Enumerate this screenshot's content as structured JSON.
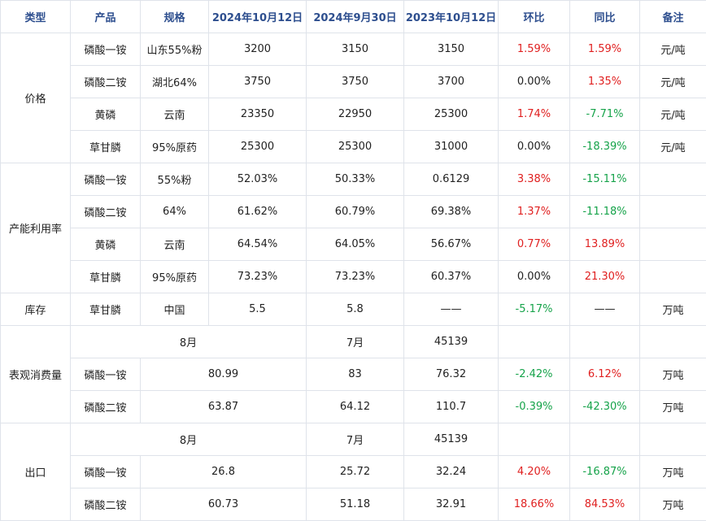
{
  "header": [
    "类型",
    "产品",
    "规格",
    "2024年10月12日",
    "2024年9月30日",
    "2023年10月12日",
    "环比",
    "同比",
    "备注"
  ],
  "sections": {
    "price": {
      "category": "价格",
      "rows": [
        {
          "product": "磷酸一铵",
          "spec": "山东55%粉",
          "v1": "3200",
          "v2": "3150",
          "v3": "3150",
          "mom": "1.59%",
          "yoy": "1.59%",
          "note": "元/吨"
        },
        {
          "product": "磷酸二铵",
          "spec": "湖北64%",
          "v1": "3750",
          "v2": "3750",
          "v3": "3700",
          "mom": "0.00%",
          "yoy": "1.35%",
          "note": "元/吨"
        },
        {
          "product": "黄磷",
          "spec": "云南",
          "v1": "23350",
          "v2": "22950",
          "v3": "25300",
          "mom": "1.74%",
          "yoy": "-7.71%",
          "note": "元/吨"
        },
        {
          "product": "草甘膦",
          "spec": "95%原药",
          "v1": "25300",
          "v2": "25300",
          "v3": "31000",
          "mom": "0.00%",
          "yoy": "-18.39%",
          "note": "元/吨"
        }
      ]
    },
    "capacity": {
      "category": "产能利用率",
      "rows": [
        {
          "product": "磷酸一铵",
          "spec": "55%粉",
          "v1": "52.03%",
          "v2": "50.33%",
          "v3": "0.6129",
          "mom": "3.38%",
          "yoy": "-15.11%",
          "note": ""
        },
        {
          "product": "磷酸二铵",
          "spec": "64%",
          "v1": "61.62%",
          "v2": "60.79%",
          "v3": "69.38%",
          "mom": "1.37%",
          "yoy": "-11.18%",
          "note": ""
        },
        {
          "product": "黄磷",
          "spec": "云南",
          "v1": "64.54%",
          "v2": "64.05%",
          "v3": "56.67%",
          "mom": "0.77%",
          "yoy": "13.89%",
          "note": ""
        },
        {
          "product": "草甘膦",
          "spec": "95%原药",
          "v1": "73.23%",
          "v2": "73.23%",
          "v3": "60.37%",
          "mom": "0.00%",
          "yoy": "21.30%",
          "note": ""
        }
      ]
    },
    "inventory": {
      "category": "库存",
      "rows": [
        {
          "product": "草甘膦",
          "spec": "中国",
          "v1": "5.5",
          "v2": "5.8",
          "v3": "——",
          "mom": "-5.17%",
          "yoy": "——",
          "note": "万吨"
        }
      ]
    },
    "consumption": {
      "category": "表观消费量",
      "subheader": {
        "c1": "8月",
        "c2": "7月",
        "c3": "45139"
      },
      "rows": [
        {
          "product": "磷酸一铵",
          "v1": "80.99",
          "v2": "83",
          "v3": "76.32",
          "mom": "-2.42%",
          "yoy": "6.12%",
          "note": "万吨"
        },
        {
          "product": "磷酸二铵",
          "v1": "63.87",
          "v2": "64.12",
          "v3": "110.7",
          "mom": "-0.39%",
          "yoy": "-42.30%",
          "note": "万吨"
        }
      ]
    },
    "export": {
      "category": "出口",
      "subheader": {
        "c1": "8月",
        "c2": "7月",
        "c3": "45139"
      },
      "rows": [
        {
          "product": "磷酸一铵",
          "v1": "26.8",
          "v2": "25.72",
          "v3": "32.24",
          "mom": "4.20%",
          "yoy": "-16.87%",
          "note": "万吨"
        },
        {
          "product": "磷酸二铵",
          "v1": "60.73",
          "v2": "51.18",
          "v3": "32.91",
          "mom": "18.66%",
          "yoy": "84.53%",
          "note": "万吨"
        }
      ]
    }
  },
  "colors": {
    "header_text": "#2d4e8e",
    "positive": "#e02020",
    "negative": "#16a34a",
    "neutral": "#222222",
    "border": "#dfe3ea"
  }
}
